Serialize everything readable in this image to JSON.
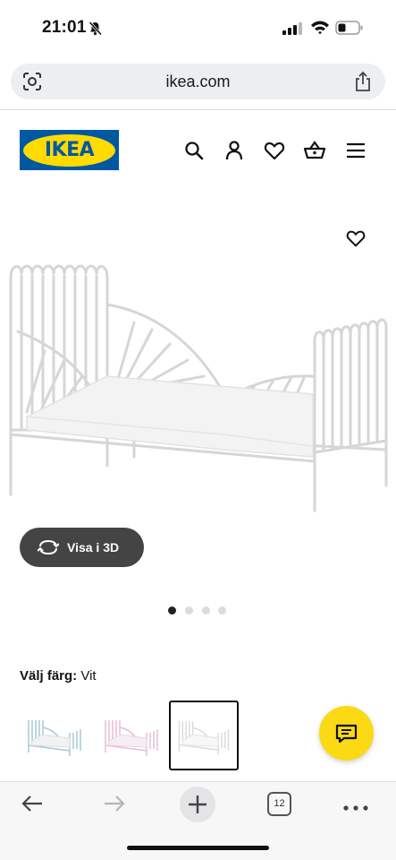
{
  "status_bar": {
    "time": "21:01",
    "icons": [
      "bell-slash-icon",
      "signal-icon",
      "wifi-icon",
      "battery-icon"
    ]
  },
  "browser": {
    "url": "ikea.com",
    "left_icon": "page-lens-icon",
    "right_icon": "share-icon",
    "tab_count": "12",
    "toolbar_icons": [
      "back-arrow-icon",
      "forward-arrow-icon",
      "plus-icon",
      "tabs-icon",
      "more-icon"
    ]
  },
  "header": {
    "logo_text": "IKEA",
    "icons": [
      "search-icon",
      "account-icon",
      "favorites-icon",
      "basket-icon",
      "menu-icon"
    ],
    "colors": {
      "blue": "#0058a3",
      "yellow": "#ffdb00"
    }
  },
  "product": {
    "view_3d_label": "Visa i 3D",
    "image_count": 4,
    "active_image_index": 0,
    "color_label": "Välj färg:",
    "color_value": "Vit",
    "swatches": [
      {
        "name": "blue-white",
        "color": "#a9c8d6"
      },
      {
        "name": "pink-white",
        "color": "#e8bcd2"
      },
      {
        "name": "white",
        "color": "#f4f4f4",
        "selected": true
      }
    ]
  },
  "chat": {
    "icon": "chat-icon",
    "color": "#fbd914"
  }
}
